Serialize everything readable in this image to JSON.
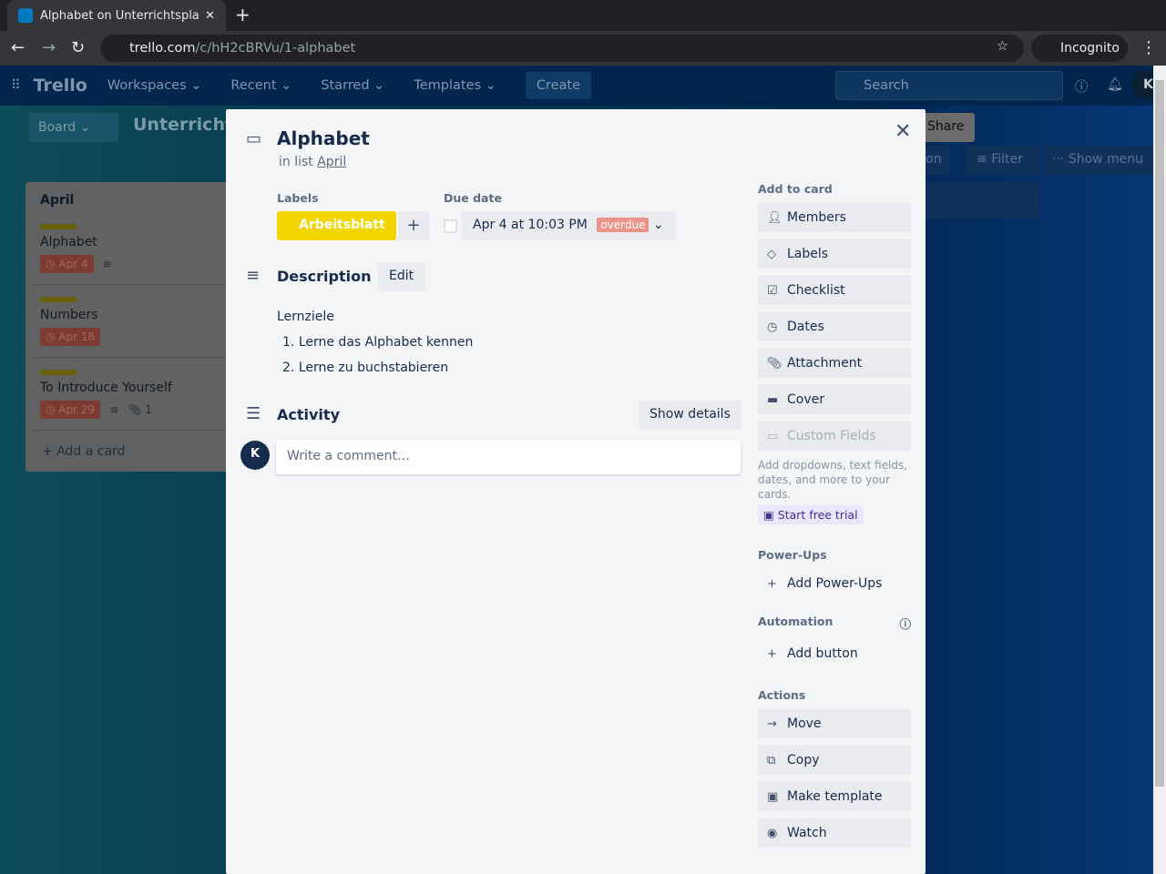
{
  "browser": {
    "tab_title": "Alphabet on Unterrichtspla",
    "url_host": "trello.com",
    "url_path": "/c/hH2cBRVu/1-alphabet",
    "incognito": "Incognito"
  },
  "header": {
    "logo": "Trello",
    "nav": [
      "Workspaces",
      "Recent",
      "Starred",
      "Templates"
    ],
    "create": "Create",
    "search_placeholder": "Search",
    "avatar": "K"
  },
  "board": {
    "view": "Board",
    "title": "Unterricht",
    "share": "Share",
    "filter": "Filter",
    "show_menu": "Show menu",
    "partial_btn": "on",
    "list": {
      "title": "April",
      "cards": [
        {
          "title": "Alphabet",
          "due": "Apr 4",
          "desc": true
        },
        {
          "title": "Numbers",
          "due": "Apr 18"
        },
        {
          "title": "To Introduce Yourself",
          "due": "Apr 29",
          "attachments": "1"
        }
      ],
      "add_card": "Add a card"
    }
  },
  "card": {
    "title": "Alphabet",
    "in_list_prefix": "in list",
    "list_name": "April",
    "labels_heading": "Labels",
    "label": "Arbeitsblatt",
    "label_color": "#f2d600",
    "due_heading": "Due date",
    "due": "Apr 4 at 10:03 PM",
    "due_status": "overdue",
    "description_heading": "Description",
    "edit": "Edit",
    "desc_title": "Lernziele",
    "desc_items": [
      "Lerne das Alphabet kennen",
      "Lerne zu buchstabieren"
    ],
    "activity_heading": "Activity",
    "show_details": "Show details",
    "comment_placeholder": "Write a comment…",
    "avatar": "K"
  },
  "sidebar": {
    "add_heading": "Add to card",
    "add": [
      "Members",
      "Labels",
      "Checklist",
      "Dates",
      "Attachment",
      "Cover",
      "Custom Fields"
    ],
    "custom_fields_note": "Add dropdowns, text fields, dates, and more to your cards.",
    "trial": "Start free trial",
    "powerups_heading": "Power-Ups",
    "add_powerups": "Add Power-Ups",
    "automation_heading": "Automation",
    "add_button": "Add button",
    "actions_heading": "Actions",
    "actions": [
      "Move",
      "Copy",
      "Make template",
      "Watch"
    ]
  }
}
